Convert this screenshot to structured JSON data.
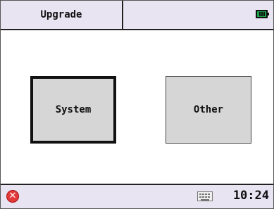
{
  "titlebar": {
    "title": "Upgrade",
    "battery_icon": "battery-full-icon"
  },
  "main": {
    "buttons": [
      {
        "label": "System",
        "selected": true
      },
      {
        "label": "Other",
        "selected": false
      }
    ]
  },
  "statusbar": {
    "close_icon": "close-icon",
    "close_glyph": "✕",
    "keyboard_icon": "keyboard-icon",
    "time": "10:24"
  }
}
